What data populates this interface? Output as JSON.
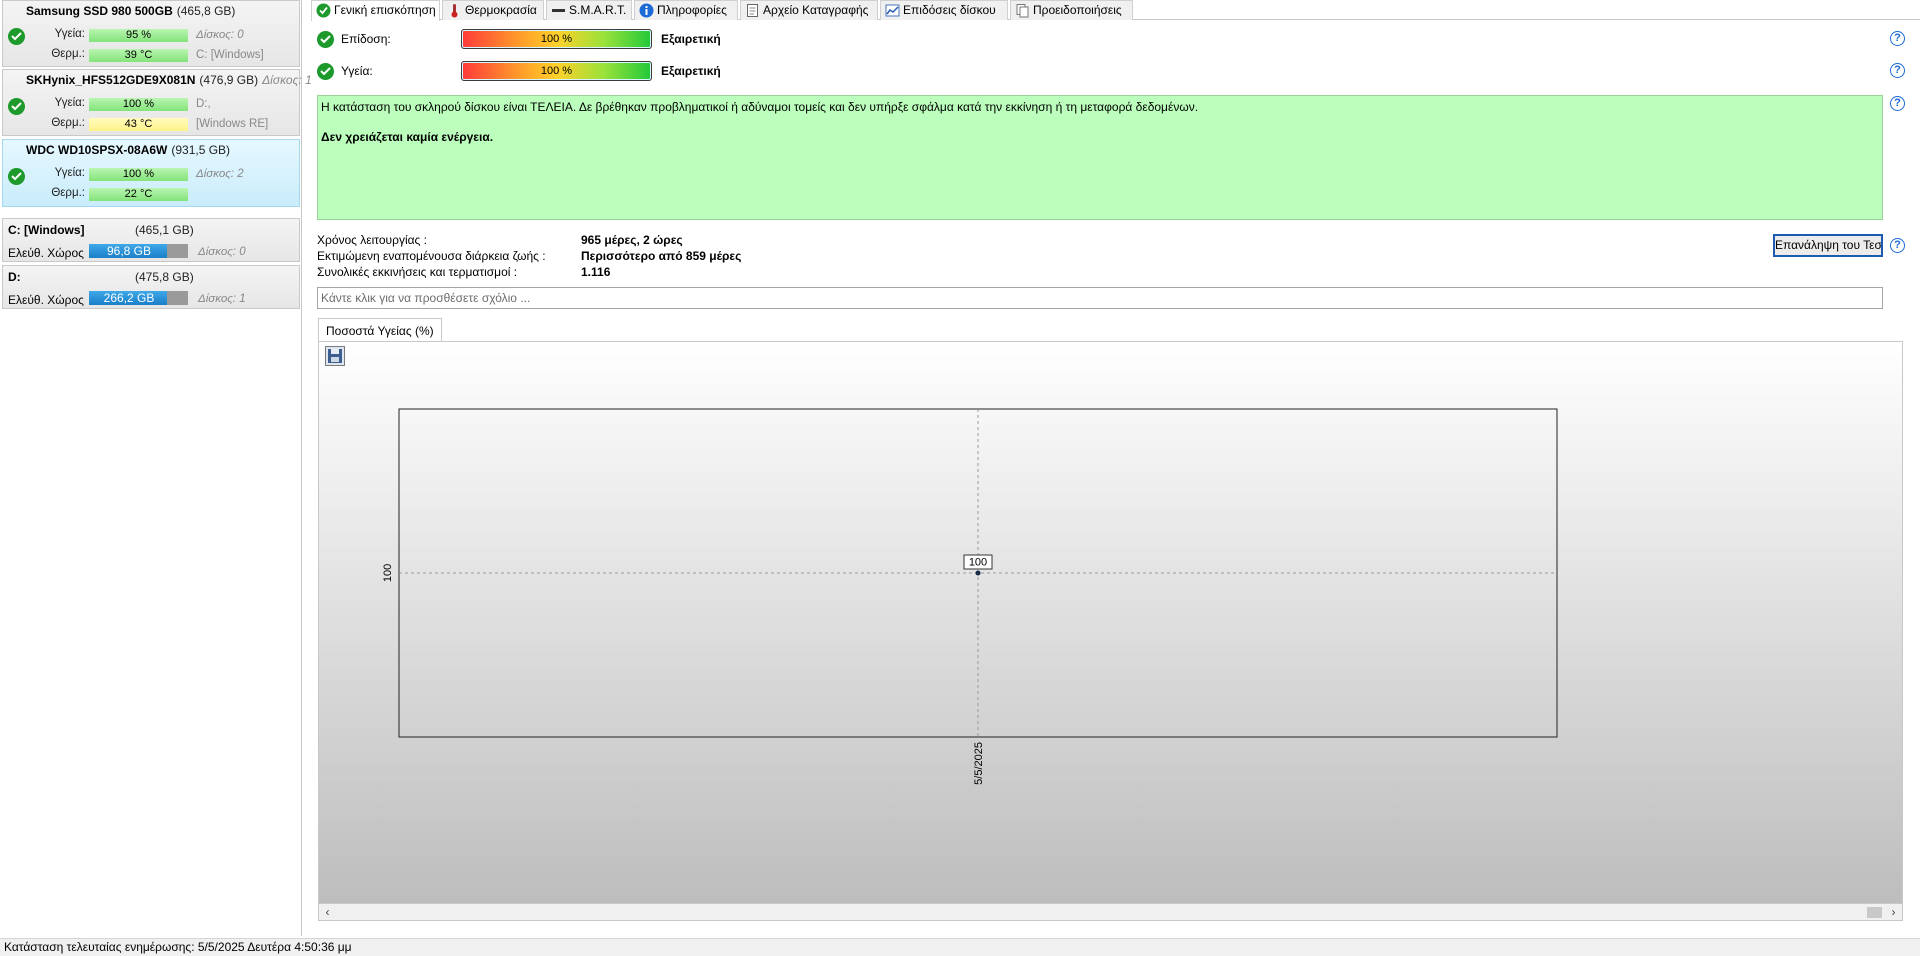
{
  "disks": [
    {
      "name": "Samsung SSD 980 500GB",
      "capacity": "(465,8 GB)",
      "disk_num": "",
      "health_label": "Υγεία:",
      "health": "95 %",
      "temp_label": "Θερμ.:",
      "temp": "39 °C",
      "note1": "Δίσκος: 0",
      "note2": "C: [Windows]",
      "temp_color": "green"
    },
    {
      "name": "SKHynix_HFS512GDE9X081N",
      "capacity": "(476,9 GB)",
      "disk_num": "Δίσκος: 1",
      "health_label": "Υγεία:",
      "health": "100 %",
      "temp_label": "Θερμ.:",
      "temp": "43 °C",
      "note1": "D:,",
      "note2": "[Windows RE]",
      "temp_color": "yellow"
    },
    {
      "name": "WDC WD10SPSX-08A6W",
      "capacity": "(931,5 GB)",
      "disk_num": "",
      "health_label": "Υγεία:",
      "health": "100 %",
      "temp_label": "Θερμ.:",
      "temp": "22 °C",
      "note1": "Δίσκος: 2",
      "note2": "",
      "temp_color": "green"
    }
  ],
  "volumes": [
    {
      "name": "C: [Windows]",
      "capacity": "(465,1 GB)",
      "free_label": "Ελεύθ. Χώρος",
      "free": "96,8 GB",
      "free_fraction": 0.79,
      "disk": "Δίσκος: 0"
    },
    {
      "name": "D:",
      "capacity": "(475,8 GB)",
      "free_label": "Ελεύθ. Χώρος",
      "free": "266,2 GB",
      "free_fraction": 0.79,
      "disk": "Δίσκος: 1"
    }
  ],
  "tabs": [
    {
      "label": "Γενική επισκόπηση",
      "icon": "check-circle-icon",
      "active": true
    },
    {
      "label": "Θερμοκρασία",
      "icon": "thermometer-icon"
    },
    {
      "label": "S.M.A.R.T.",
      "icon": "dash-icon"
    },
    {
      "label": "Πληροφορίες",
      "icon": "info-icon"
    },
    {
      "label": "Αρχείο Καταγραφής",
      "icon": "log-file-icon"
    },
    {
      "label": "Επιδόσεις δίσκου",
      "icon": "chart-icon"
    },
    {
      "label": "Προειδοποιήσεις",
      "icon": "alerts-icon"
    }
  ],
  "overview": {
    "performance_label": "Επίδοση:",
    "performance_value": "100 %",
    "performance_word": "Εξαιρετική",
    "health_label": "Υγεία:",
    "health_value": "100 %",
    "health_word": "Εξαιρετική",
    "status_text": "Η κατάσταση του σκληρού δίσκου είναι ΤΕΛΕΙΑ. Δε βρέθηκαν προβληματικοί ή αδύναμοι τομείς και δεν υπήρξε σφάλμα κατά την εκκίνηση ή τη μεταφορά δεδομένων.",
    "action_text": "Δεν χρειάζεται καμία ενέργεια.",
    "info": [
      {
        "label": "Χρόνος λειτουργίας :",
        "value": "965 μέρες, 2 ώρες"
      },
      {
        "label": "Εκτιμώμενη εναπομένουσα διάρκεια ζωής :",
        "value": "Περισσότερο από 859 μέρες"
      },
      {
        "label": "Συνολικές εκκινήσεις και τερματισμοί :",
        "value": "1.116"
      }
    ],
    "retest_button": "Επανάληψη του Τεστ",
    "comment_placeholder": "Κάντε κλικ για να προσθέσετε σχόλιο ...",
    "help": "?"
  },
  "chart_tab": "Ποσοστά Υγείας (%)",
  "chart_data": {
    "type": "scatter",
    "title": "",
    "x": [
      "5/5/2025"
    ],
    "series": [
      {
        "values": [
          100
        ]
      }
    ],
    "y_tick_labels": [
      "100"
    ],
    "x_tick_labels": [
      "5/5/2025"
    ],
    "data_labels": [
      "100"
    ],
    "grid": true
  },
  "statusbar": "Κατάσταση τελευταίας ενημέρωσης: 5/5/2025 Δευτέρα 4:50:36 μμ",
  "colors": {
    "accent": "#1d5bb3",
    "good": "#1d9a2b",
    "status_bg": "#bcffbc"
  }
}
